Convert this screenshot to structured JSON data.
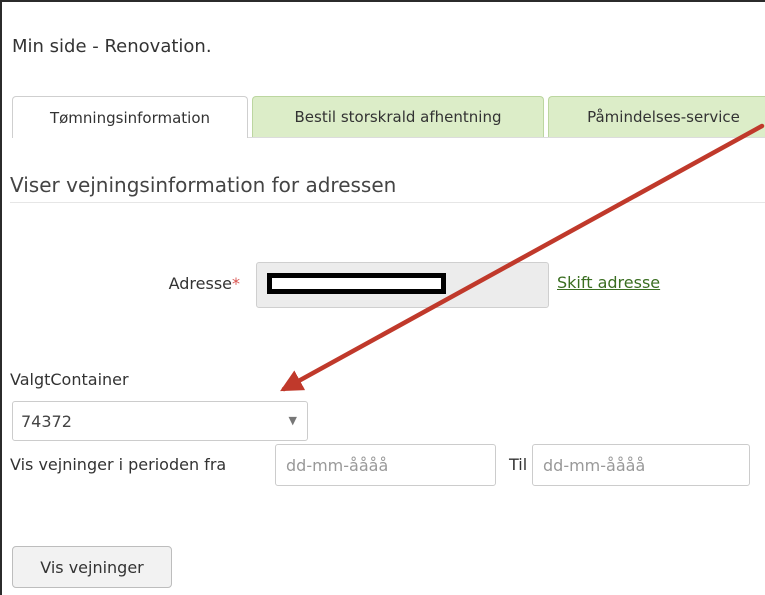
{
  "page": {
    "title": "Min side - Renovation."
  },
  "tabs": [
    {
      "label": "Tømningsinformation",
      "active": true
    },
    {
      "label": "Bestil storskrald afhentning",
      "active": false
    },
    {
      "label": "Påmindelses-service",
      "active": false
    }
  ],
  "section": {
    "heading": "Viser vejningsinformation for adressen"
  },
  "address": {
    "label": "Adresse",
    "required_mark": "*",
    "value": "",
    "change_link": "Skift adresse"
  },
  "container": {
    "label": "ValgtContainer",
    "selected": "74372"
  },
  "period": {
    "label": "Vis vejninger i perioden fra",
    "from_placeholder": "dd-mm-åååå",
    "to_label": "Til",
    "to_placeholder": "dd-mm-åååå"
  },
  "submit": {
    "label": "Vis vejninger"
  },
  "colors": {
    "tab_inactive_bg": "#dcedc8",
    "link": "#3a6e21",
    "required": "#d9534f",
    "annotation_arrow": "#c0392b"
  },
  "icons": {
    "select_caret": "caret-down-icon",
    "annotation": "red-arrow-annotation"
  }
}
